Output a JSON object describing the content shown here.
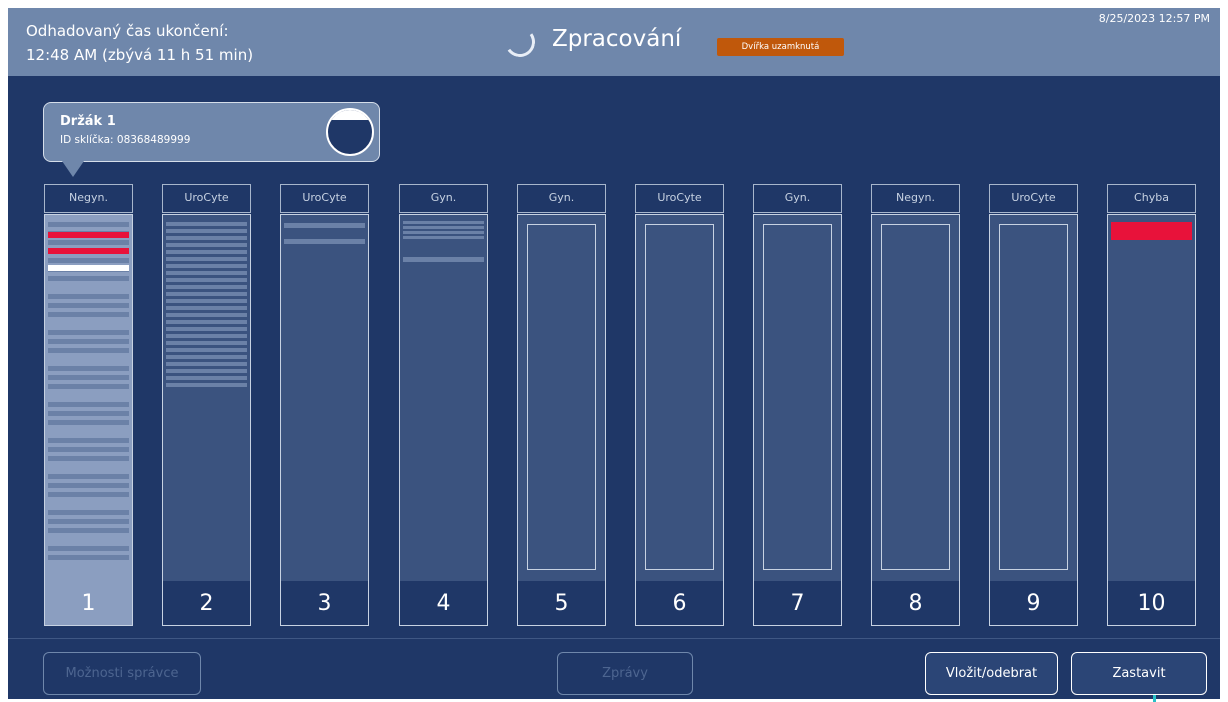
{
  "header": {
    "eta_label": "Odhadovaný čas ukončení:",
    "eta_value": "12:48 AM (zbývá 11 h 51 min)",
    "status_title": "Zpracování",
    "door_badge": "Dvířka uzamknutá",
    "datetime": "8/25/2023 12:57 PM",
    "spinner_icon": "loading-spinner-icon"
  },
  "tooltip": {
    "title": "Držák 1",
    "slide_id": "ID sklíčka: 08368489999",
    "fill_icon": "vial-fill-level-icon"
  },
  "racks": [
    {
      "type": "Negyn.",
      "number": "1",
      "selected": true
    },
    {
      "type": "UroCyte",
      "number": "2"
    },
    {
      "type": "UroCyte",
      "number": "3"
    },
    {
      "type": "Gyn.",
      "number": "4"
    },
    {
      "type": "Gyn.",
      "number": "5"
    },
    {
      "type": "UroCyte",
      "number": "6"
    },
    {
      "type": "Gyn.",
      "number": "7"
    },
    {
      "type": "Negyn.",
      "number": "8"
    },
    {
      "type": "UroCyte",
      "number": "9"
    },
    {
      "type": "Chyba",
      "number": "10"
    }
  ],
  "footer": {
    "admin_options": "Možnosti správce",
    "messages": "Zprávy",
    "insert_remove": "Vložit/odebrat",
    "stop": "Zastavit"
  },
  "colors": {
    "background": "#1f3767",
    "header": "#6f87ab",
    "badge": "#c0580b",
    "error": "#e8123a"
  }
}
